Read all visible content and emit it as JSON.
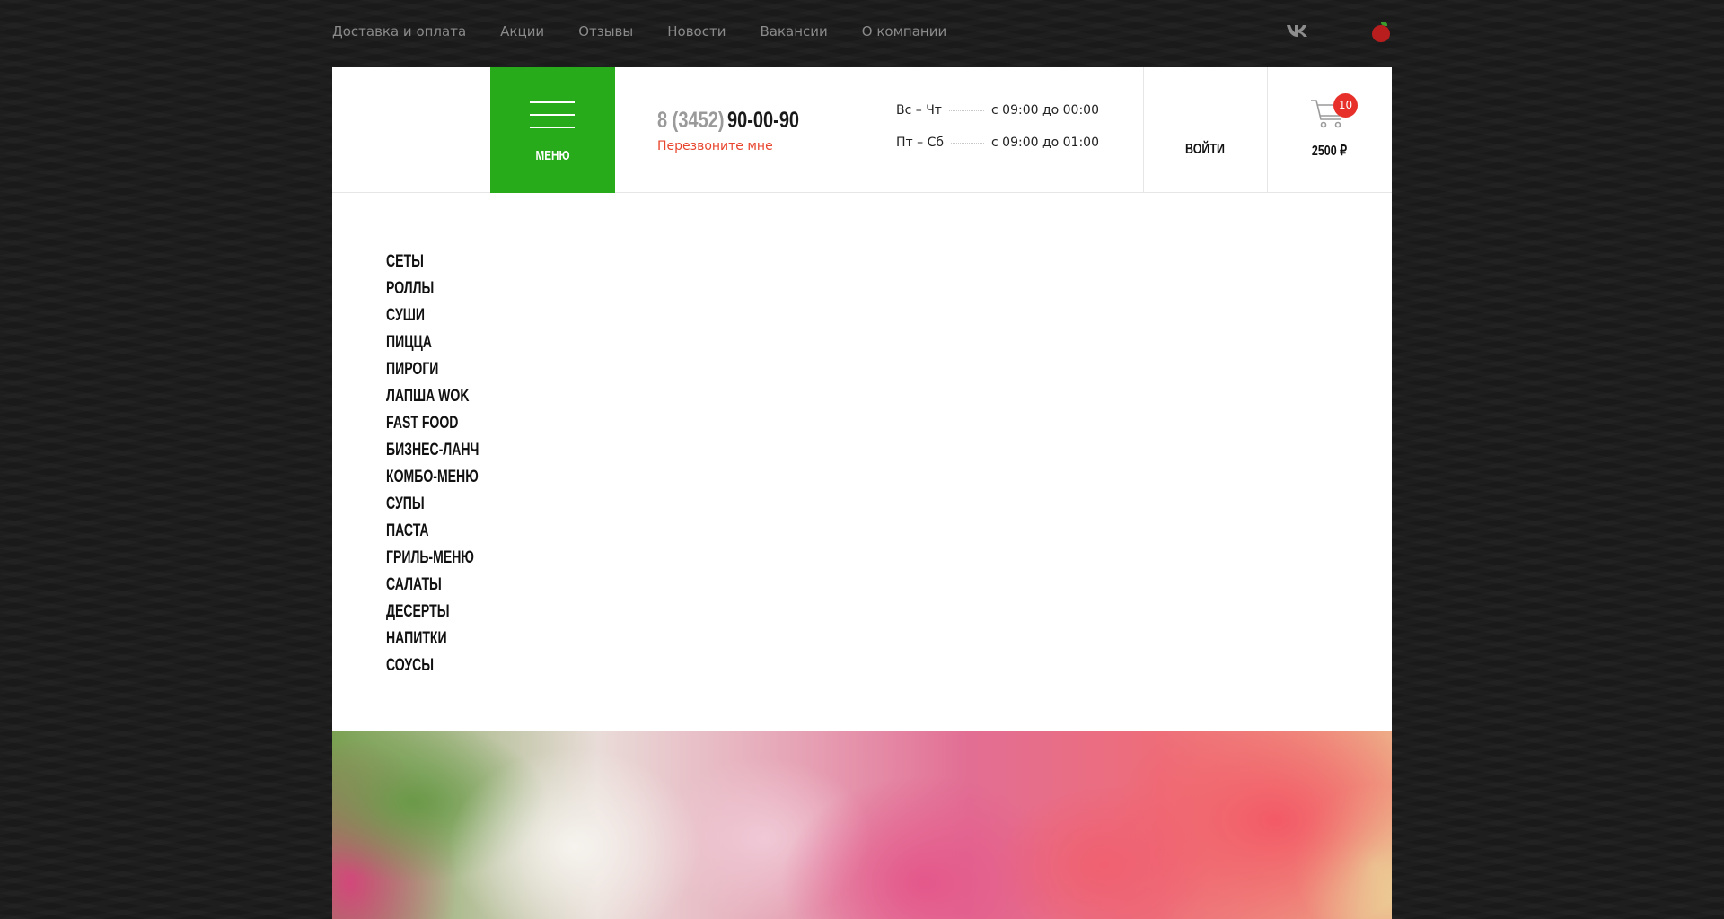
{
  "topnav": {
    "links": [
      "Доставка и оплата",
      "Акции",
      "Отзывы",
      "Новости",
      "Вакансии",
      "О компании"
    ],
    "social_icon": "vk-icon",
    "brand_icon": "apple-icon"
  },
  "header": {
    "menu_label": "Меню",
    "phone_code": "8 (3452)",
    "phone_number": "90-00-90",
    "callback_label": "Перезвоните мне",
    "hours": [
      {
        "days": "Вс – Чт",
        "time": "с 09:00 до 00:00"
      },
      {
        "days": "Пт – Сб",
        "time": "с 09:00 до 01:00"
      }
    ],
    "login_label": "Войти",
    "cart_count": "10",
    "cart_total": "2500 ₽"
  },
  "categories": [
    "Сеты",
    "Роллы",
    "Суши",
    "Пицца",
    "Пироги",
    "Лапша WOK",
    "Fast Food",
    "Бизнес-ланч",
    "Комбо-меню",
    "Супы",
    "Паста",
    "Гриль-меню",
    "Салаты",
    "Десерты",
    "Напитки",
    "Соусы"
  ],
  "colors": {
    "accent_green": "#28ab1a",
    "accent_red": "#e8302a",
    "callback_red": "#e8452e"
  }
}
